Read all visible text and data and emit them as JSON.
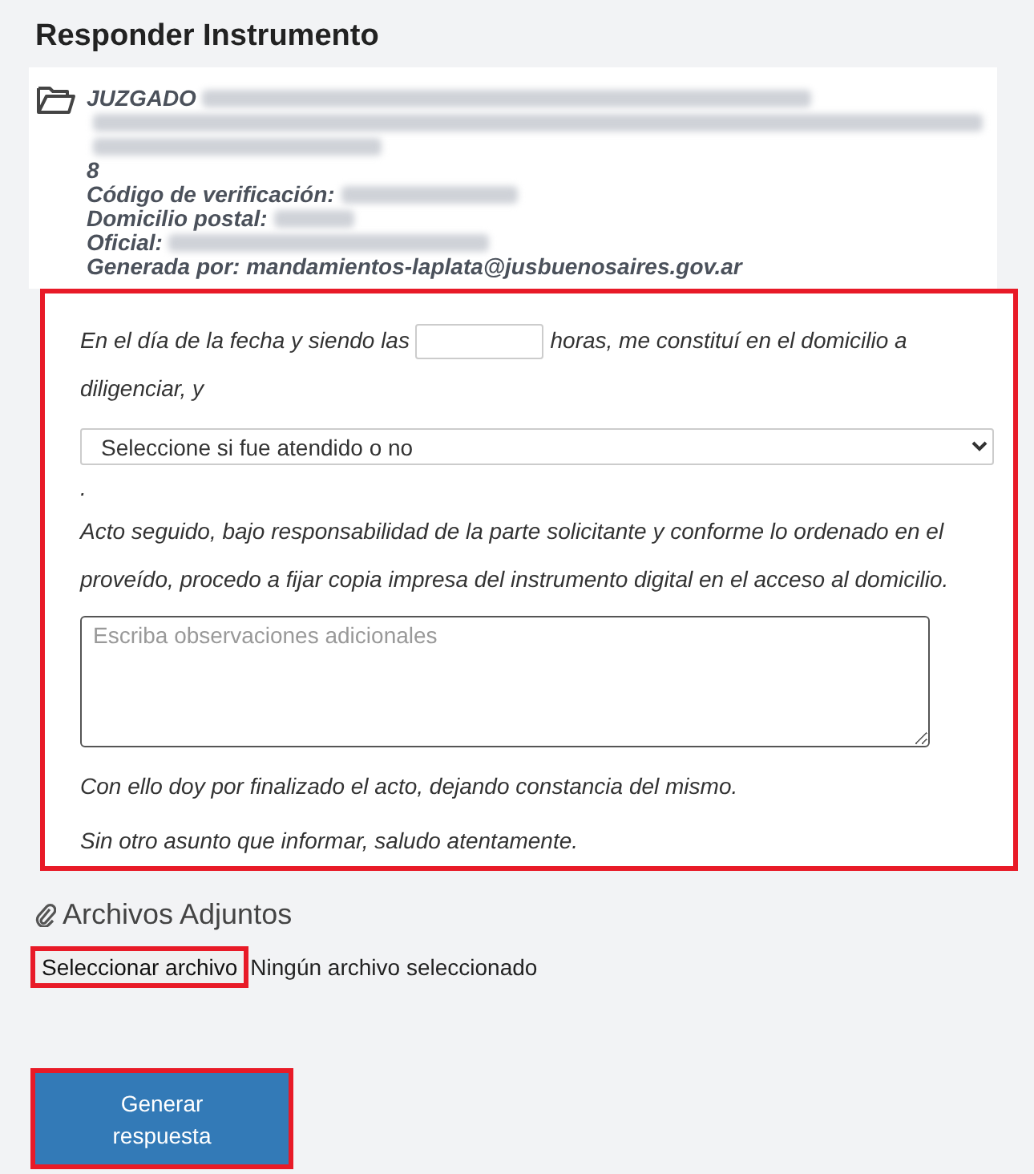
{
  "title": "Responder Instrumento",
  "header": {
    "court_label": "JUZGADO",
    "number": "8",
    "fields": [
      {
        "label": "Código de verificación:",
        "redacted": true
      },
      {
        "label": "Domicilio postal:",
        "redacted": true
      },
      {
        "label": "Oficial:",
        "redacted": true
      },
      {
        "label": "Generada por: mandamientos-laplata@jusbuenosaires.gov.ar",
        "redacted": false
      }
    ]
  },
  "form": {
    "highlighted": true,
    "intro_before": "En el día de la fecha y siendo las",
    "intro_after": "horas, me constituí en el domicilio a",
    "intro_continued": "diligenciar, y",
    "attended_select": "Seleccione si fue atendido o no",
    "period": ".",
    "action_text": "Acto seguido, bajo responsabilidad de la parte solicitante y conforme lo ordenado en el proveído, procedo a fijar copia impresa del instrumento digital en el acceso al domicilio.",
    "observations": {
      "placeholder": "Escriba observaciones adicionales"
    },
    "closing": [
      "Con ello doy por finalizado el acto, dejando constancia del mismo.",
      "Sin otro asunto que informar, saludo atentamente."
    ]
  },
  "attachments": {
    "title": "Archivos Adjuntos",
    "file_button": {
      "label": "Seleccionar archivo",
      "highlighted": true
    },
    "file_status": "Ningún archivo seleccionado"
  },
  "submit": {
    "label": "Generar respuesta",
    "highlighted": true
  }
}
